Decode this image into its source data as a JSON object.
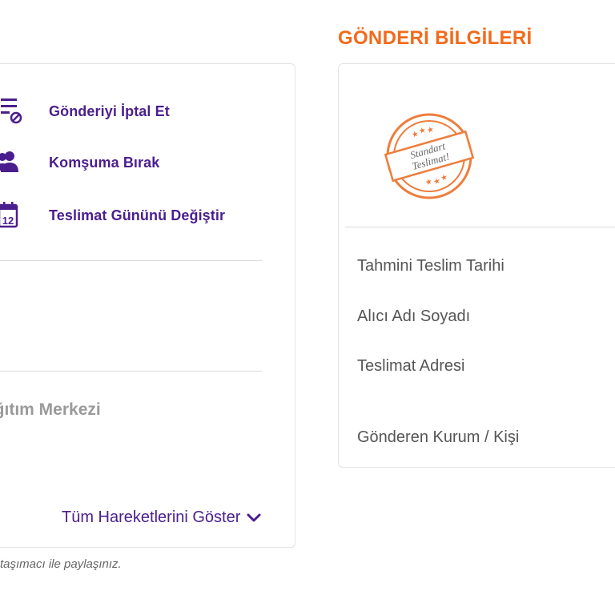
{
  "actions": [
    {
      "label": "Gönderiyi İptal Et",
      "icon": "cancel-shipment-icon"
    },
    {
      "label": "Komşuma Bırak",
      "icon": "neighbor-users-icon"
    },
    {
      "label": "Teslimat Gününü Değiştir",
      "icon": "calendar-icon"
    }
  ],
  "calendar_day": "12",
  "distribution_center": "ağıtım Merkezi",
  "show_all": "Tüm Hareketlerini Göster",
  "footnote": "taşımacı ile paylaşınız.",
  "shipment_info": {
    "title": "GÖNDERİ BİLGİLERİ",
    "stamp_line1": "Standart",
    "stamp_line2": "Teslimat!",
    "labels": [
      "Tahmini Teslim Tarihi",
      "Alıcı Adı Soyadı",
      "Teslimat Adresi",
      "Gönderen Kurum / Kişi"
    ]
  },
  "colors": {
    "purple": "#4b1e8e",
    "orange": "#f26a1b"
  }
}
